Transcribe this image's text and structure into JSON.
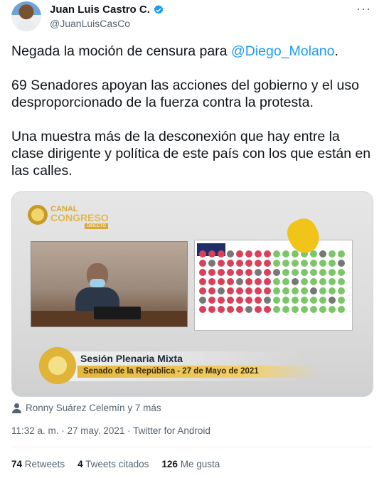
{
  "author": {
    "name": "Juan Luis Castro C.",
    "handle": "@JuanLuisCasCo",
    "verified_color": "#1d9bf0"
  },
  "menu": {
    "more_icon": "more-horizontal-icon",
    "label": "···"
  },
  "tweet": {
    "p1_text": "Negada la moción de censura para ",
    "p1_mention": "@Diego_Molano",
    "p1_end": ".",
    "p2": "69 Senadores apoyan las acciones del gobierno y el uso desproporcionado de la fuerza contra la protesta.",
    "p3": "Una muestra más de la desconexión que hay entre la clase dirigente y política de este país con los que están en las calles."
  },
  "media": {
    "channel_line1": "CANAL",
    "channel_line2": "CONGRESO",
    "live_badge": "DIRECTO",
    "lower_title": "Sesión Plenaria Mixta",
    "lower_subtitle": "Senado de la República - 27 de Mayo de 2021"
  },
  "tagged": "Ronny Suárez Celemín y 7 más",
  "meta": "11:32 a. m. · 27 may. 2021 · Twitter for Android",
  "stats": {
    "retweets_count": "74",
    "retweets_label": "Retweets",
    "quotes_count": "4",
    "quotes_label": "Tweets citados",
    "likes_count": "126",
    "likes_label": "Me gusta"
  },
  "colors": {
    "accent": "#1d9bf0",
    "secondary_text": "#536471",
    "vote_yes": "#7cc66a",
    "vote_no": "#d9415a"
  }
}
